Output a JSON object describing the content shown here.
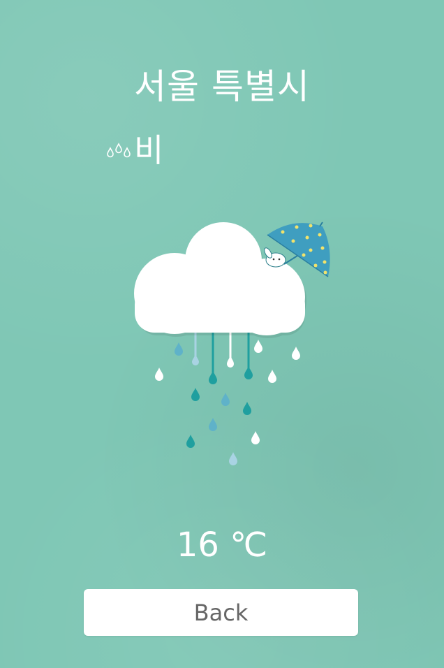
{
  "location": {
    "city": "서울 특별시"
  },
  "weather": {
    "icon": "rain-drops-icon",
    "condition": "비"
  },
  "illustration": {
    "icon": "rain-cloud-umbrella-icon"
  },
  "temperature": {
    "value": "16",
    "unit": "℃"
  },
  "actions": {
    "back_label": "Back"
  },
  "colors": {
    "background": "#7fc7b5",
    "accent_teal": "#1f9f9f",
    "light_blue": "#a9d3e3",
    "umbrella": "#3f9ec0",
    "umbrella_dots": "#f2e36b",
    "button_text": "#666666"
  }
}
